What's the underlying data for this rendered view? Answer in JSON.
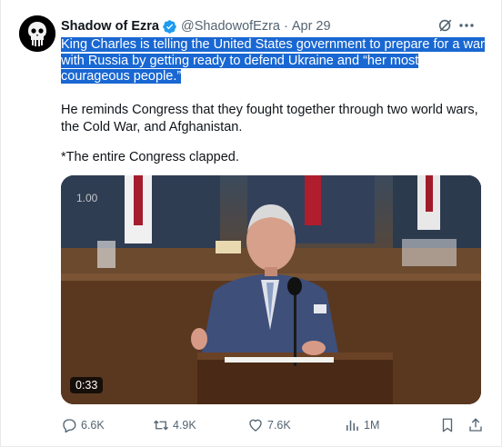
{
  "tweet": {
    "display_name": "Shadow of Ezra",
    "handle": "@ShadowofEzra",
    "separator": "·",
    "date": "Apr 29",
    "highlighted_text": "King Charles is telling the United States government to prepare for a war with Russia by getting ready to defend Ukraine and “her most courageous people.”",
    "paragraph_2": "He reminds Congress that they fought together through two world wars, the Cold War, and Afghanistan.",
    "paragraph_3": "*The entire Congress clapped."
  },
  "media": {
    "speed_label": "1.00",
    "duration": "0:33"
  },
  "actions": {
    "replies": "6.6K",
    "reposts": "4.9K",
    "likes": "7.6K",
    "views": "1M"
  },
  "icons": {
    "avatar": "skull-emblem-icon",
    "verified": "verified-badge-icon",
    "grok": "grok-icon",
    "more": "more-dots-icon",
    "reply": "reply-icon",
    "repost": "repost-icon",
    "like": "heart-icon",
    "views": "views-chart-icon",
    "bookmark": "bookmark-icon",
    "share": "share-icon"
  },
  "colors": {
    "verified_blue": "#1d9bf0",
    "text_primary": "#0f1419",
    "text_secondary": "#536471",
    "selection_highlight": "#1967d2"
  }
}
